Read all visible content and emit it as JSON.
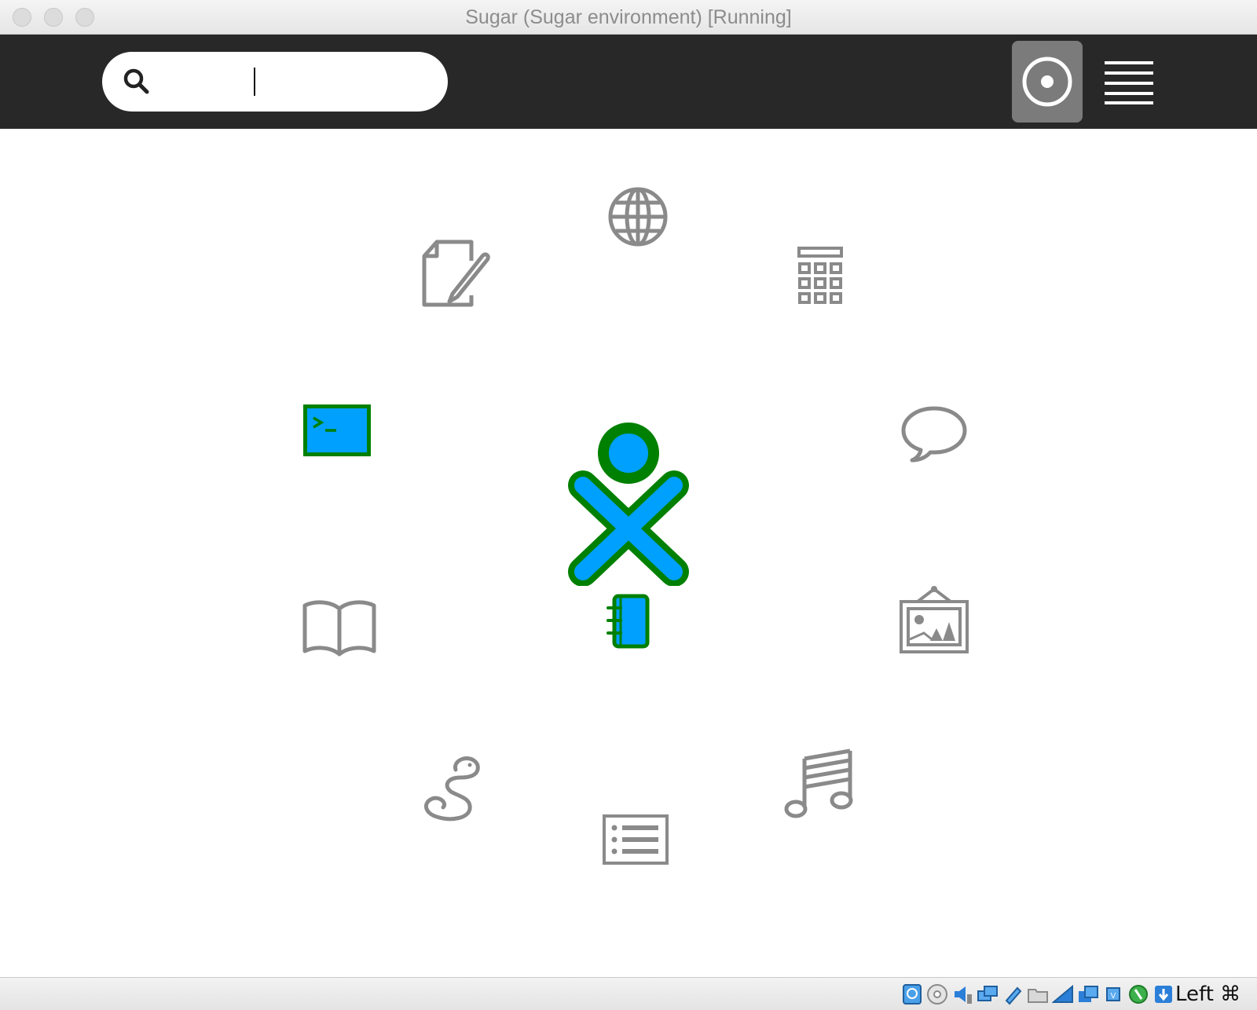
{
  "window": {
    "title": "Sugar (Sugar environment) [Running]"
  },
  "toolbar": {
    "search": {
      "value": "",
      "placeholder": ""
    },
    "views": [
      {
        "icon": "home-view-icon",
        "active": true
      },
      {
        "icon": "list-view-icon",
        "active": false
      }
    ]
  },
  "home_ring": {
    "center": {
      "icon": "xo-user-icon",
      "stroke_color": "#008000",
      "fill_color": "#00a0ff"
    },
    "journal": {
      "icon": "journal-icon"
    },
    "activities": [
      {
        "icon": "web-browser-icon",
        "active": false
      },
      {
        "icon": "calculator-icon",
        "active": false
      },
      {
        "icon": "chat-icon",
        "active": false
      },
      {
        "icon": "image-viewer-icon",
        "active": false
      },
      {
        "icon": "music-icon",
        "active": false
      },
      {
        "icon": "list-icon",
        "active": false
      },
      {
        "icon": "python-snake-icon",
        "active": false
      },
      {
        "icon": "read-book-icon",
        "active": false
      },
      {
        "icon": "terminal-icon",
        "active": true
      },
      {
        "icon": "write-document-icon",
        "active": false
      }
    ],
    "inactive_color": "#8a8a8a"
  },
  "statusbar": {
    "icons": [
      "hard-disk-icon",
      "optical-drive-icon",
      "audio-icon",
      "network-icon",
      "shared-folders-icon",
      "usb-icon",
      "display-icon",
      "screen-capture-icon",
      "video-capture-icon",
      "cpu-icon",
      "mouse-integration-icon",
      "keyboard-capture-icon"
    ],
    "host_key": "Left ⌘"
  }
}
